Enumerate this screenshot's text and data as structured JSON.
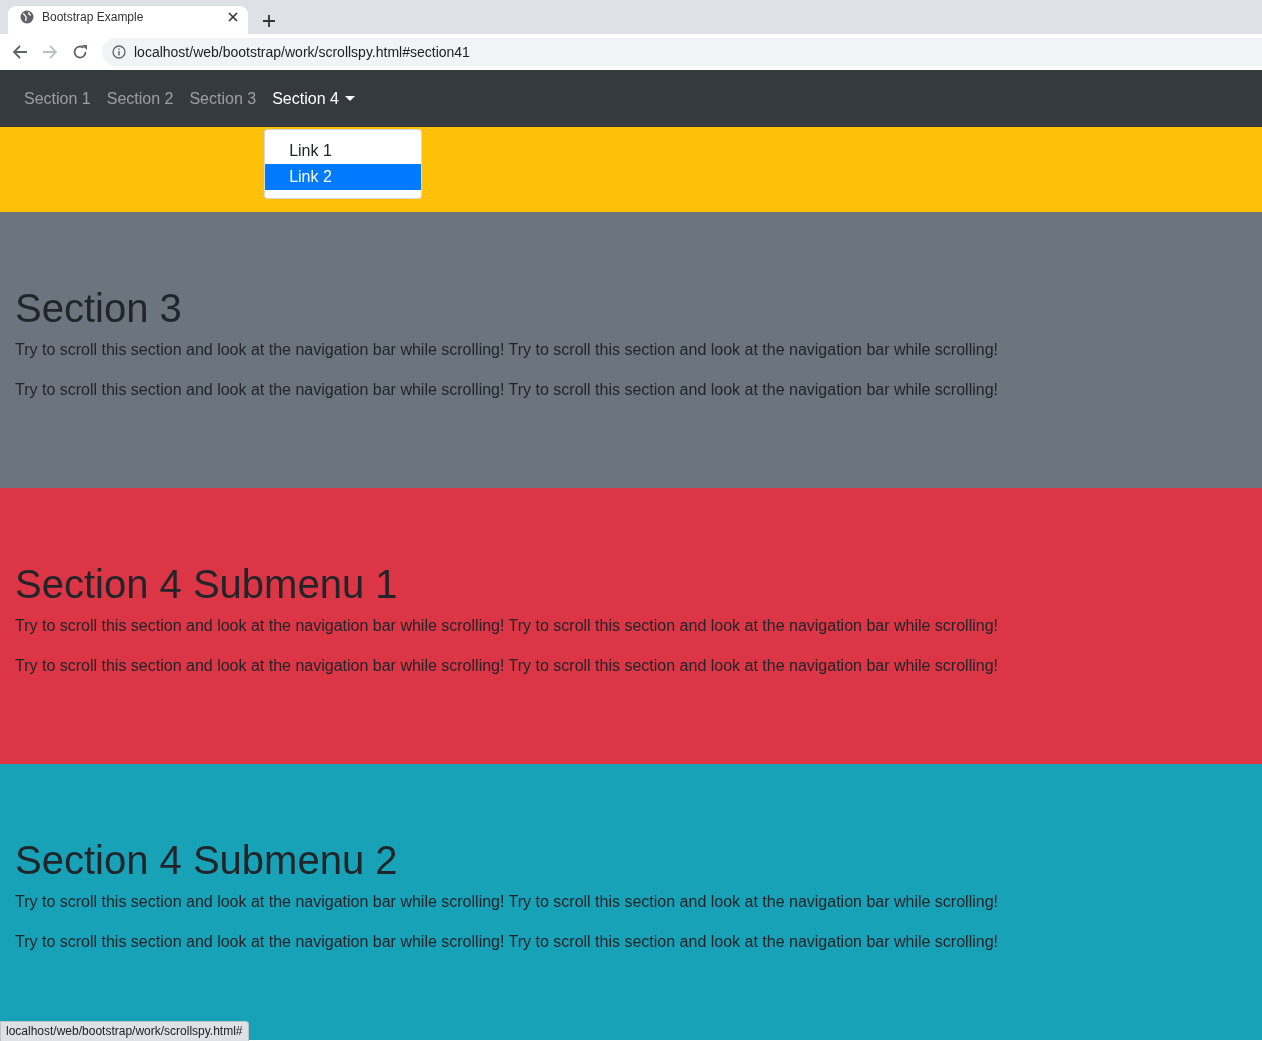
{
  "browser": {
    "tab_title": "Bootstrap Example",
    "address": "localhost/web/bootstrap/work/scrollspy.html#section41"
  },
  "navbar": {
    "items": [
      {
        "label": "Section 1",
        "selected": false,
        "kind": "link"
      },
      {
        "label": "Section 2",
        "selected": false,
        "kind": "link"
      },
      {
        "label": "Section 3",
        "selected": false,
        "kind": "link"
      },
      {
        "label": "Section 4",
        "selected": true,
        "kind": "dropdown",
        "expanded": true,
        "menu": [
          {
            "label": "Link 1",
            "selected": false
          },
          {
            "label": "Link 2",
            "selected": true
          }
        ]
      }
    ]
  },
  "sections": [
    {
      "color": "#ffc107"
    },
    {
      "color": "#6c757d",
      "heading": "Section 3",
      "paragraphs": [
        "Try to scroll this section and look at the navigation bar while scrolling! Try to scroll this section and look at the navigation bar while scrolling!",
        "Try to scroll this section and look at the navigation bar while scrolling! Try to scroll this section and look at the navigation bar while scrolling!"
      ]
    },
    {
      "color": "#dc3545",
      "heading": "Section 4 Submenu 1",
      "paragraphs": [
        "Try to scroll this section and look at the navigation bar while scrolling! Try to scroll this section and look at the navigation bar while scrolling!",
        "Try to scroll this section and look at the navigation bar while scrolling! Try to scroll this section and look at the navigation bar while scrolling!"
      ]
    },
    {
      "color": "#17a2b8",
      "heading": "Section 4 Submenu 2",
      "paragraphs": [
        "Try to scroll this section and look at the navigation bar while scrolling! Try to scroll this section and look at the navigation bar while scrolling!",
        "Try to scroll this section and look at the navigation bar while scrolling! Try to scroll this section and look at the navigation bar while scrolling!"
      ]
    }
  ],
  "status_bar": {
    "text": "localhost/web/bootstrap/work/scrollspy.html#"
  }
}
